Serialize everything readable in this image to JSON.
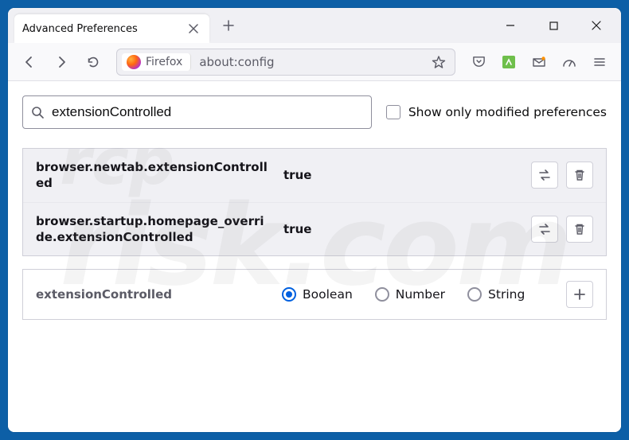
{
  "window": {
    "tab_title": "Advanced Preferences"
  },
  "urlbar": {
    "identity_label": "Firefox",
    "url": "about:config"
  },
  "search": {
    "value": "extensionControlled",
    "checkbox_label": "Show only modified preferences"
  },
  "prefs": [
    {
      "name": "browser.newtab.extensionControlled",
      "value": "true"
    },
    {
      "name": "browser.startup.homepage_override.extensionControlled",
      "value": "true"
    }
  ],
  "new_pref": {
    "name": "extensionControlled",
    "options": [
      "Boolean",
      "Number",
      "String"
    ],
    "selected": "Boolean"
  },
  "watermark": {
    "top": "rcp",
    "bottom": "risk.com"
  }
}
